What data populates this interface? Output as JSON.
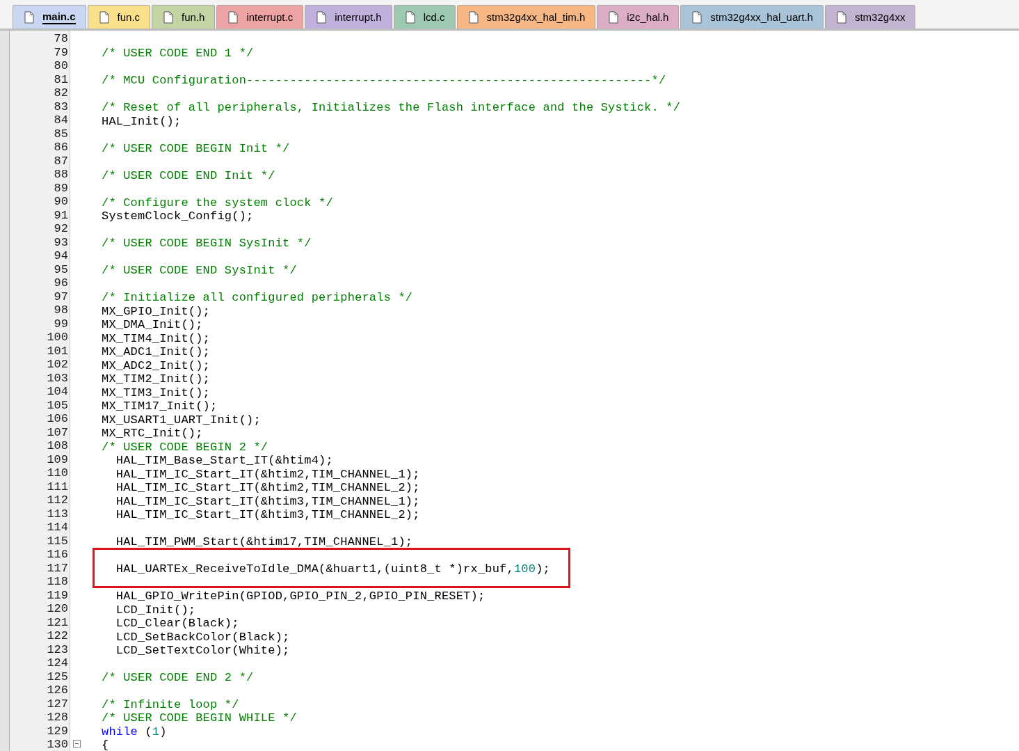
{
  "tabs": [
    {
      "label": "main.c",
      "selected": true,
      "color": "#c9d7f2"
    },
    {
      "label": "fun.c",
      "selected": false,
      "color": "#fbe08c"
    },
    {
      "label": "fun.h",
      "selected": false,
      "color": "#c4d4a4"
    },
    {
      "label": "interrupt.c",
      "selected": false,
      "color": "#eda3a3"
    },
    {
      "label": "interrupt.h",
      "selected": false,
      "color": "#c0b0dd"
    },
    {
      "label": "lcd.c",
      "selected": false,
      "color": "#9dc8b2"
    },
    {
      "label": "stm32g4xx_hal_tim.h",
      "selected": false,
      "color": "#f7b785"
    },
    {
      "label": "i2c_hal.h",
      "selected": false,
      "color": "#dbadc7"
    },
    {
      "label": "stm32g4xx_hal_uart.h",
      "selected": false,
      "color": "#a9c3d9"
    },
    {
      "label": "stm32g4xx",
      "selected": false,
      "color": "#c2b3d0"
    }
  ],
  "lines": [
    {
      "number": "78"
    },
    {
      "number": "79",
      "segments": [
        {
          "kind": "comment",
          "text": "/* USER CODE END 1 */"
        }
      ]
    },
    {
      "number": "80"
    },
    {
      "number": "81",
      "segments": [
        {
          "kind": "comment",
          "text": "/* MCU Configuration--------------------------------------------------------*/"
        }
      ]
    },
    {
      "number": "82"
    },
    {
      "number": "83",
      "segments": [
        {
          "kind": "comment",
          "text": "/* Reset of all peripherals, Initializes the Flash interface and the Systick. */"
        }
      ]
    },
    {
      "number": "84",
      "segments": [
        {
          "kind": "code",
          "text": "HAL_Init();"
        }
      ]
    },
    {
      "number": "85"
    },
    {
      "number": "86",
      "segments": [
        {
          "kind": "comment",
          "text": "/* USER CODE BEGIN Init */"
        }
      ]
    },
    {
      "number": "87"
    },
    {
      "number": "88",
      "segments": [
        {
          "kind": "comment",
          "text": "/* USER CODE END Init */"
        }
      ]
    },
    {
      "number": "89"
    },
    {
      "number": "90",
      "segments": [
        {
          "kind": "comment",
          "text": "/* Configure the system clock */"
        }
      ]
    },
    {
      "number": "91",
      "segments": [
        {
          "kind": "code",
          "text": "SystemClock_Config();"
        }
      ]
    },
    {
      "number": "92"
    },
    {
      "number": "93",
      "segments": [
        {
          "kind": "comment",
          "text": "/* USER CODE BEGIN SysInit */"
        }
      ]
    },
    {
      "number": "94"
    },
    {
      "number": "95",
      "segments": [
        {
          "kind": "comment",
          "text": "/* USER CODE END SysInit */"
        }
      ]
    },
    {
      "number": "96"
    },
    {
      "number": "97",
      "segments": [
        {
          "kind": "comment",
          "text": "/* Initialize all configured peripherals */"
        }
      ]
    },
    {
      "number": "98",
      "segments": [
        {
          "kind": "code",
          "text": "MX_GPIO_Init();"
        }
      ]
    },
    {
      "number": "99",
      "segments": [
        {
          "kind": "code",
          "text": "MX_DMA_Init();"
        }
      ]
    },
    {
      "number": "100",
      "segments": [
        {
          "kind": "code",
          "text": "MX_TIM4_Init();"
        }
      ]
    },
    {
      "number": "101",
      "segments": [
        {
          "kind": "code",
          "text": "MX_ADC1_Init();"
        }
      ]
    },
    {
      "number": "102",
      "segments": [
        {
          "kind": "code",
          "text": "MX_ADC2_Init();"
        }
      ]
    },
    {
      "number": "103",
      "segments": [
        {
          "kind": "code",
          "text": "MX_TIM2_Init();"
        }
      ]
    },
    {
      "number": "104",
      "segments": [
        {
          "kind": "code",
          "text": "MX_TIM3_Init();"
        }
      ]
    },
    {
      "number": "105",
      "segments": [
        {
          "kind": "code",
          "text": "MX_TIM17_Init();"
        }
      ]
    },
    {
      "number": "106",
      "segments": [
        {
          "kind": "code",
          "text": "MX_USART1_UART_Init();"
        }
      ]
    },
    {
      "number": "107",
      "segments": [
        {
          "kind": "code",
          "text": "MX_RTC_Init();"
        }
      ]
    },
    {
      "number": "108",
      "segments": [
        {
          "kind": "comment",
          "text": "/* USER CODE BEGIN 2 */"
        }
      ]
    },
    {
      "number": "109",
      "segments": [
        {
          "kind": "code",
          "text": "  HAL_TIM_Base_Start_IT(&htim4);"
        }
      ]
    },
    {
      "number": "110",
      "segments": [
        {
          "kind": "code",
          "text": "  HAL_TIM_IC_Start_IT(&htim2,TIM_CHANNEL_1);"
        }
      ]
    },
    {
      "number": "111",
      "segments": [
        {
          "kind": "code",
          "text": "  HAL_TIM_IC_Start_IT(&htim2,TIM_CHANNEL_2);"
        }
      ]
    },
    {
      "number": "112",
      "segments": [
        {
          "kind": "code",
          "text": "  HAL_TIM_IC_Start_IT(&htim3,TIM_CHANNEL_1);"
        }
      ]
    },
    {
      "number": "113",
      "segments": [
        {
          "kind": "code",
          "text": "  HAL_TIM_IC_Start_IT(&htim3,TIM_CHANNEL_2);"
        }
      ]
    },
    {
      "number": "114"
    },
    {
      "number": "115",
      "segments": [
        {
          "kind": "code",
          "text": "  HAL_TIM_PWM_Start(&htim17,TIM_CHANNEL_1);"
        }
      ]
    },
    {
      "number": "116",
      "boxed": true
    },
    {
      "number": "117",
      "boxed": true,
      "segments": [
        {
          "kind": "code",
          "text": "  HAL_UARTEx_ReceiveToIdle_DMA(&huart1,(uint8_t *)rx_buf,"
        },
        {
          "kind": "number",
          "text": "100"
        },
        {
          "kind": "code",
          "text": ");"
        }
      ]
    },
    {
      "number": "118",
      "boxed": true
    },
    {
      "number": "119",
      "segments": [
        {
          "kind": "code",
          "text": "  HAL_GPIO_WritePin(GPIOD,GPIO_PIN_2,GPIO_PIN_RESET);"
        }
      ]
    },
    {
      "number": "120",
      "segments": [
        {
          "kind": "code",
          "text": "  LCD_Init();"
        }
      ]
    },
    {
      "number": "121",
      "segments": [
        {
          "kind": "code",
          "text": "  LCD_Clear(Black);"
        }
      ]
    },
    {
      "number": "122",
      "segments": [
        {
          "kind": "code",
          "text": "  LCD_SetBackColor(Black);"
        }
      ]
    },
    {
      "number": "123",
      "segments": [
        {
          "kind": "code",
          "text": "  LCD_SetTextColor(White);"
        }
      ]
    },
    {
      "number": "124"
    },
    {
      "number": "125",
      "segments": [
        {
          "kind": "comment",
          "text": "/* USER CODE END 2 */"
        }
      ]
    },
    {
      "number": "126"
    },
    {
      "number": "127",
      "segments": [
        {
          "kind": "comment",
          "text": "/* Infinite loop */"
        }
      ]
    },
    {
      "number": "128",
      "segments": [
        {
          "kind": "comment",
          "text": "/* USER CODE BEGIN WHILE */"
        }
      ]
    },
    {
      "number": "129",
      "segments": [
        {
          "kind": "keyword",
          "text": "while"
        },
        {
          "kind": "code",
          "text": " ("
        },
        {
          "kind": "number",
          "text": "1"
        },
        {
          "kind": "code",
          "text": ")"
        }
      ]
    },
    {
      "number": "130",
      "fold_expanded": true,
      "segments": [
        {
          "kind": "code",
          "text": "{"
        }
      ]
    }
  ]
}
